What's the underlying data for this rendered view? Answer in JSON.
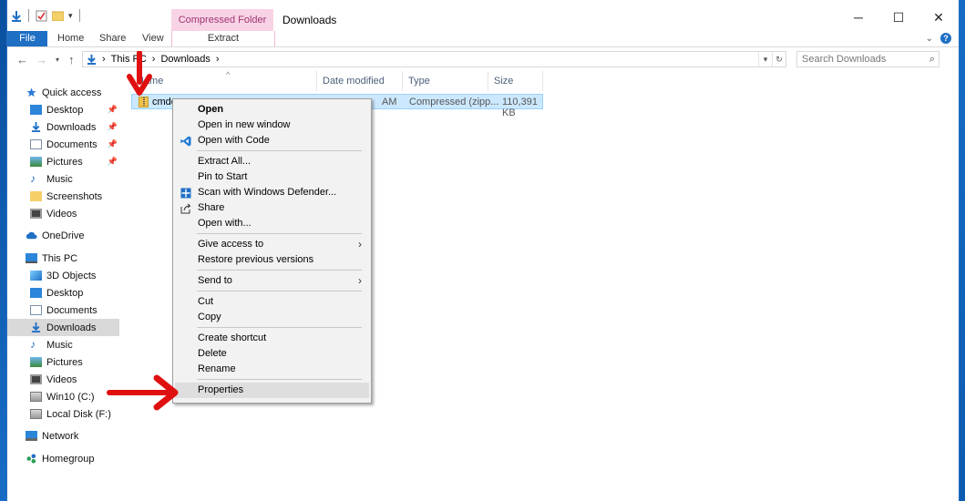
{
  "window": {
    "title": "Downloads",
    "contextual_tab_group": "Compressed Folder Tools"
  },
  "ribbon": {
    "tabs": [
      "File",
      "Home",
      "Share",
      "View",
      "Extract"
    ]
  },
  "address_bar": {
    "crumbs": [
      "This PC",
      "Downloads"
    ],
    "separator": "›"
  },
  "search": {
    "placeholder": "Search Downloads"
  },
  "sidebar": {
    "quick_access": "Quick access",
    "quick_items": [
      "Desktop",
      "Downloads",
      "Documents",
      "Pictures",
      "Music",
      "Screenshots",
      "Videos"
    ],
    "onedrive": "OneDrive",
    "this_pc": "This PC",
    "pc_items": [
      "3D Objects",
      "Desktop",
      "Documents",
      "Downloads",
      "Music",
      "Pictures",
      "Videos",
      "Win10 (C:)",
      "Local Disk (F:)"
    ],
    "network": "Network",
    "homegroup": "Homegroup",
    "selected": "Downloads"
  },
  "columns": {
    "name": "Name",
    "date": "Date modified",
    "type": "Type",
    "size": "Size"
  },
  "file": {
    "name": "cmder",
    "date": "AM",
    "type": "Compressed (zipp...",
    "size": "110,391 KB"
  },
  "context_menu": {
    "items": [
      "Open",
      "Open in new window",
      "Open with Code",
      "Extract All...",
      "Pin to Start",
      "Scan with Windows Defender...",
      "Share",
      "Open with...",
      "Give access to",
      "Restore previous versions",
      "Send to",
      "Cut",
      "Copy",
      "Create shortcut",
      "Delete",
      "Rename",
      "Properties"
    ]
  },
  "colors": {
    "accent": "#1f6fc5",
    "selection": "#cce8ff",
    "annotation_arrow": "#e01010"
  }
}
